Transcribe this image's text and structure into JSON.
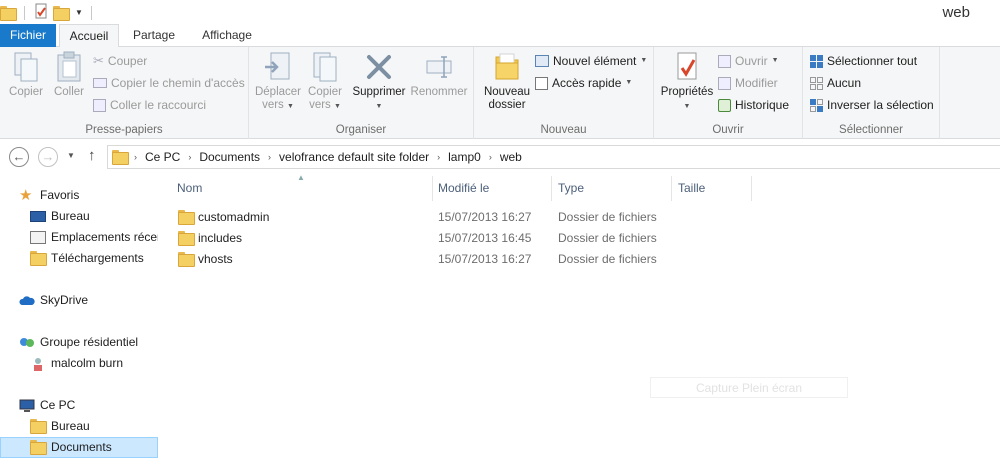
{
  "window": {
    "title": "web"
  },
  "tabs": {
    "file": "Fichier",
    "home": "Accueil",
    "share": "Partage",
    "view": "Affichage"
  },
  "ribbon": {
    "clipboard": {
      "label": "Presse-papiers",
      "copy": "Copier",
      "paste": "Coller",
      "cut": "Couper",
      "copy_path": "Copier le chemin d'accès",
      "paste_shortcut": "Coller le raccourci"
    },
    "organize": {
      "label": "Organiser",
      "move_to_1": "Déplacer",
      "move_to_2": "vers",
      "copy_to_1": "Copier",
      "copy_to_2": "vers",
      "delete": "Supprimer",
      "rename": "Renommer"
    },
    "new": {
      "label": "Nouveau",
      "new_folder_1": "Nouveau",
      "new_folder_2": "dossier",
      "new_item": "Nouvel élément",
      "easy_access": "Accès rapide"
    },
    "open": {
      "label": "Ouvrir",
      "properties": "Propriétés",
      "open": "Ouvrir",
      "edit": "Modifier",
      "history": "Historique"
    },
    "select": {
      "label": "Sélectionner",
      "select_all": "Sélectionner tout",
      "select_none": "Aucun",
      "invert": "Inverser la sélection"
    }
  },
  "address": {
    "crumbs": [
      "Ce PC",
      "Documents",
      "velofrance default site folder",
      "lamp0",
      "web"
    ]
  },
  "nav": {
    "favorites": "Favoris",
    "desktop": "Bureau",
    "recent": "Emplacements récents",
    "downloads": "Téléchargements",
    "skydrive": "SkyDrive",
    "homegroup": "Groupe résidentiel",
    "user": "malcolm burn",
    "this_pc": "Ce PC",
    "pc_desktop": "Bureau",
    "pc_documents": "Documents"
  },
  "columns": {
    "name": "Nom",
    "modified": "Modifié le",
    "type": "Type",
    "size": "Taille"
  },
  "files": [
    {
      "name": "customadmin",
      "modified": "15/07/2013 16:27",
      "type": "Dossier de fichiers"
    },
    {
      "name": "includes",
      "modified": "15/07/2013 16:45",
      "type": "Dossier de fichiers"
    },
    {
      "name": "vhosts",
      "modified": "15/07/2013 16:27",
      "type": "Dossier de fichiers"
    }
  ],
  "watermark": "Capture Plein écran",
  "colors": {
    "file_tab": "#1979ca",
    "selection": "#cce8ff",
    "ribbon_bg": "#f5f6f7"
  }
}
